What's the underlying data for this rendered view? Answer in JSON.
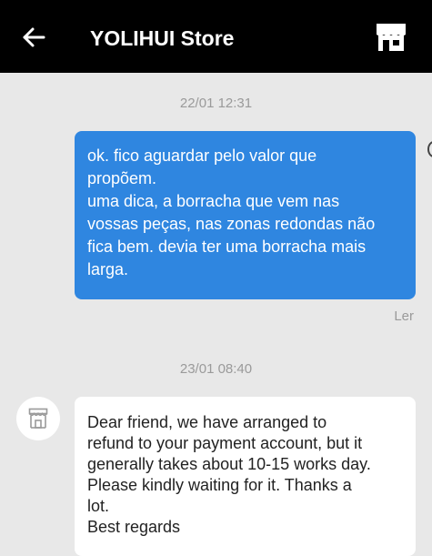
{
  "header": {
    "back_icon": "arrow-left-icon",
    "title": "YOLIHUI Store",
    "store_icon": "storefront-icon"
  },
  "messages": [
    {
      "timestamp": "22/01 12:31",
      "direction": "outgoing",
      "lines": [
        "ok. fico aguardar pelo valor que",
        "propõem.",
        "uma dica, a borracha que vem nas",
        "vossas peças, nas zonas redondas não",
        "fica bem. devia ter uma borracha mais",
        "larga."
      ],
      "status": "Ler"
    },
    {
      "timestamp": "23/01 08:40",
      "direction": "incoming",
      "lines": [
        "Dear friend, we have arranged to",
        "refund to your payment account, but it",
        "generally takes about 10-15 works day.",
        "Please kindly waiting for it. Thanks a",
        "lot.",
        "Best regards"
      ]
    }
  ],
  "colors": {
    "header_bg": "#000000",
    "page_bg": "#e8e8e8",
    "outgoing_bubble": "#2f86e0",
    "incoming_bubble": "#ffffff",
    "timestamp_text": "#9a9a9a"
  }
}
